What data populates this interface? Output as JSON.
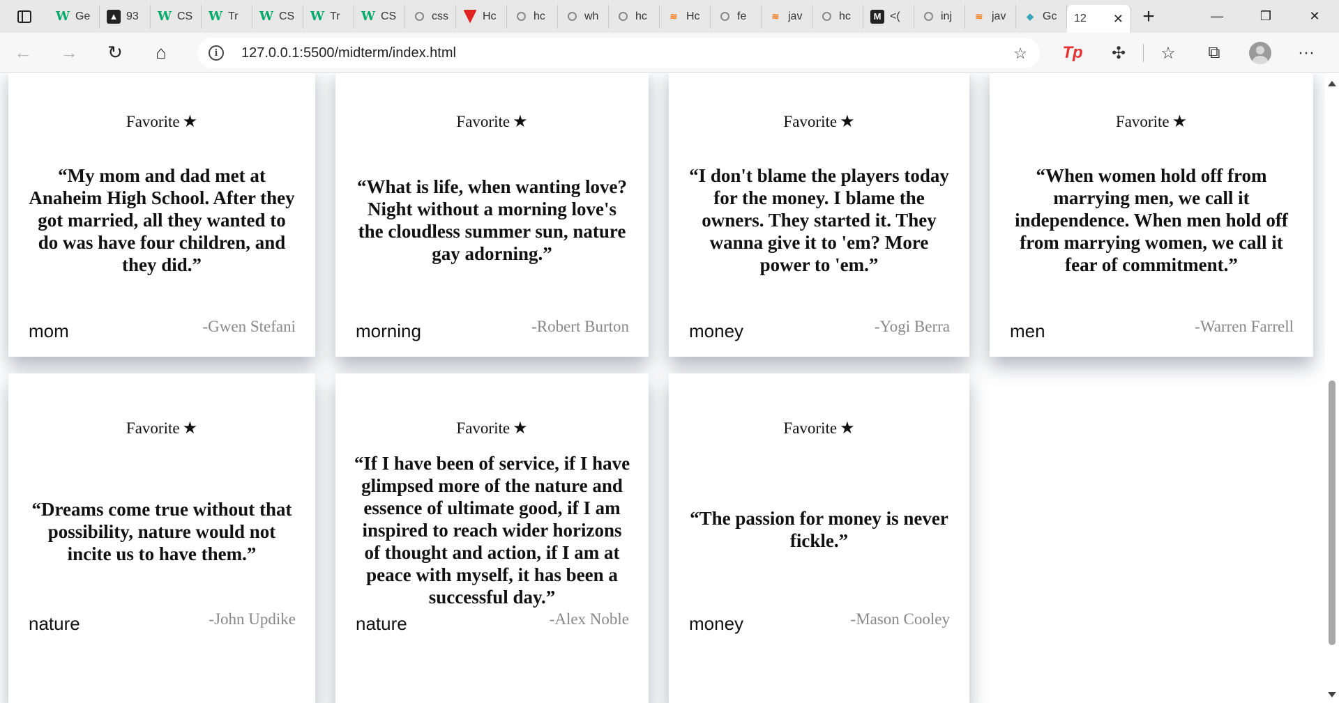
{
  "browser": {
    "tabs": [
      {
        "icon": "w3schools-icon",
        "title": "Ge"
      },
      {
        "icon": "dark-cursor-icon",
        "title": "93"
      },
      {
        "icon": "w3schools-icon",
        "title": "CS"
      },
      {
        "icon": "w3schools-icon",
        "title": "Tr"
      },
      {
        "icon": "w3schools-icon",
        "title": "CS"
      },
      {
        "icon": "w3schools-icon",
        "title": "Tr"
      },
      {
        "icon": "w3schools-icon",
        "title": "CS"
      },
      {
        "icon": "search-icon",
        "title": "css"
      },
      {
        "icon": "red-triangle-icon",
        "title": "Hc"
      },
      {
        "icon": "search-icon",
        "title": "hc"
      },
      {
        "icon": "search-icon",
        "title": "wh"
      },
      {
        "icon": "search-icon",
        "title": "hc"
      },
      {
        "icon": "stackoverflow-icon",
        "title": "Hc"
      },
      {
        "icon": "search-icon",
        "title": "fe"
      },
      {
        "icon": "stackoverflow-icon",
        "title": "jav"
      },
      {
        "icon": "search-icon",
        "title": "hc"
      },
      {
        "icon": "medium-icon",
        "title": "<("
      },
      {
        "icon": "search-icon",
        "title": "inj"
      },
      {
        "icon": "stackoverflow-icon",
        "title": "jav"
      },
      {
        "icon": "teal-shape-icon",
        "title": "Gc"
      }
    ],
    "active_tab": {
      "title": "12",
      "close": "✕"
    },
    "new_tab": "+",
    "window_controls": {
      "minimize": "—",
      "restore": "❐",
      "close": "✕"
    },
    "nav": {
      "back": "←",
      "forward": "→",
      "reload": "↻",
      "home": "⌂"
    },
    "url": "127.0.0.1:5500/midterm/index.html",
    "tools": {
      "tp": "Tp",
      "extensions": "✣",
      "favorites": "☆",
      "collections": "⧉",
      "more": "···"
    }
  },
  "favorite_label": "Favorite",
  "favorite_star": "★",
  "cards": [
    {
      "quote": "“My mom and dad met at Anaheim High School. After they got married, all they wanted to do was have four children, and they did.”",
      "tag": "mom",
      "author": "-Gwen Stefani"
    },
    {
      "quote": "“What is life, when wanting love? Night without a morning love's the cloudless summer sun, nature gay adorning.”",
      "tag": "morning",
      "author": "-Robert Burton"
    },
    {
      "quote": "“I don't blame the players today for the money. I blame the owners. They started it. They wanna give it to 'em? More power to 'em.”",
      "tag": "money",
      "author": "-Yogi Berra"
    },
    {
      "quote": "“When women hold off from marrying men, we call it independence. When men hold off from marrying women, we call it fear of commitment.”",
      "tag": "men",
      "author": "-Warren Farrell"
    },
    {
      "quote": "“Dreams come true without that possibility, nature would not incite us to have them.”",
      "tag": "nature",
      "author": "-John Updike"
    },
    {
      "quote": "“If I have been of service, if I have glimpsed more of the nature and essence of ultimate good, if I am inspired to reach wider horizons of thought and action, if I am at peace with myself, it has been a successful day.”",
      "tag": "nature",
      "author": "-Alex Noble"
    },
    {
      "quote": "“The passion for money is never fickle.”",
      "tag": "money",
      "author": "-Mason Cooley"
    }
  ]
}
